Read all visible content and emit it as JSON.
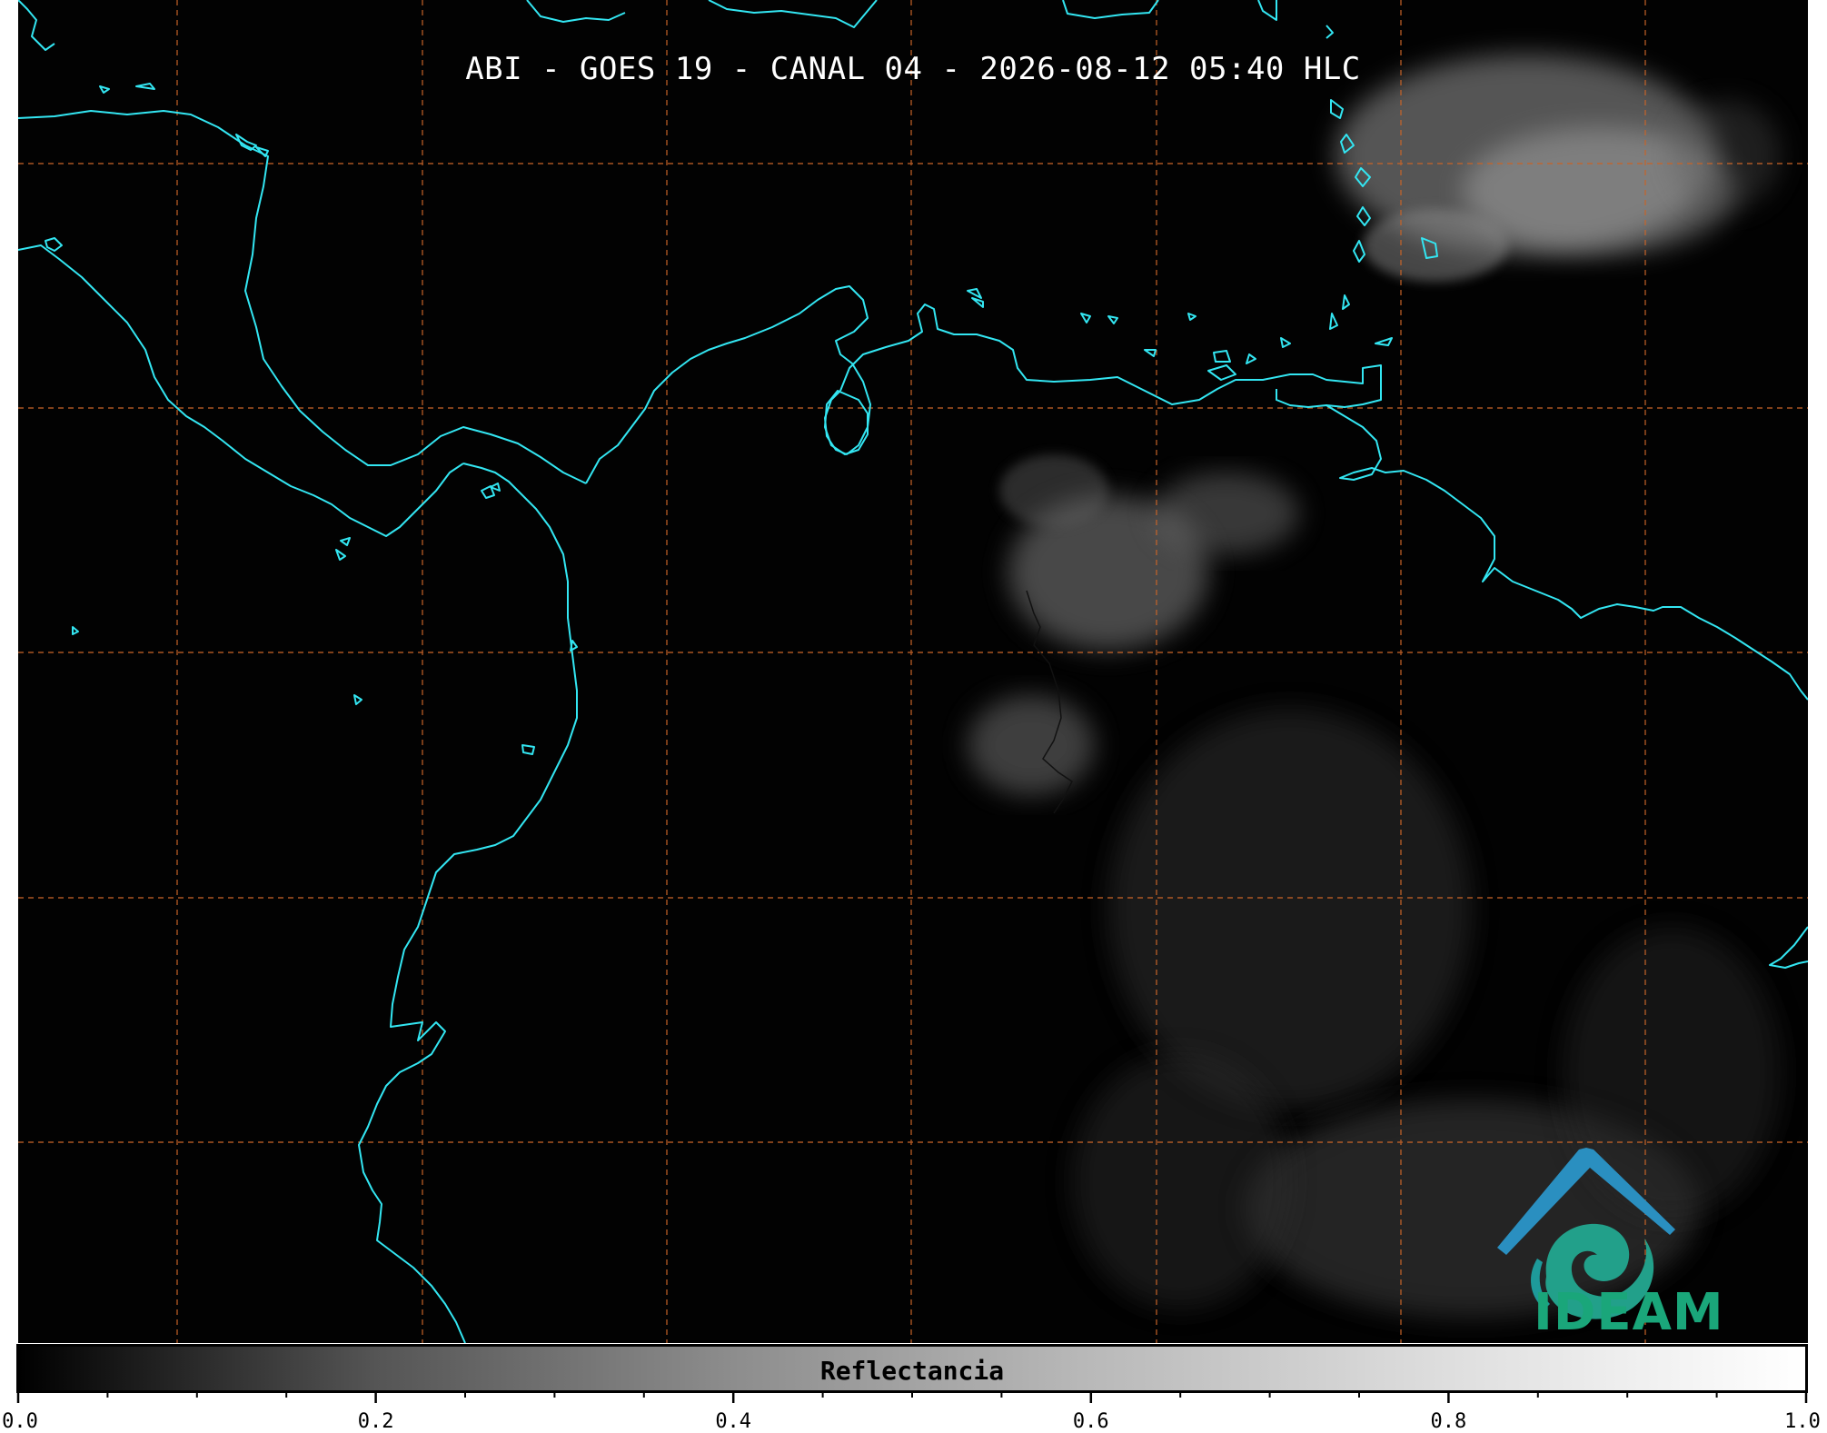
{
  "title": "ABI - GOES 19 - CANAL 04 - 2026-08-12 05:40 HLC",
  "colorbar": {
    "label": "Reflectancia",
    "min": 0.0,
    "max": 1.0,
    "tick_labels": [
      "0.0",
      "0.2",
      "0.4",
      "0.6",
      "0.8",
      "1.0"
    ],
    "minor_ticks_per_interval": 3
  },
  "logo": {
    "text": "IDEAM",
    "icon": "ideam-spiral-mountain-logo"
  },
  "colors": {
    "background": "#020202",
    "coastline": "#33e6f2",
    "gridline": "#c86428",
    "logo_blue": "#2a8fc0",
    "logo_green": "#1aa67a"
  },
  "gridlines": {
    "style": "dashed",
    "vertical_count": 7,
    "horizontal_count": 5
  }
}
